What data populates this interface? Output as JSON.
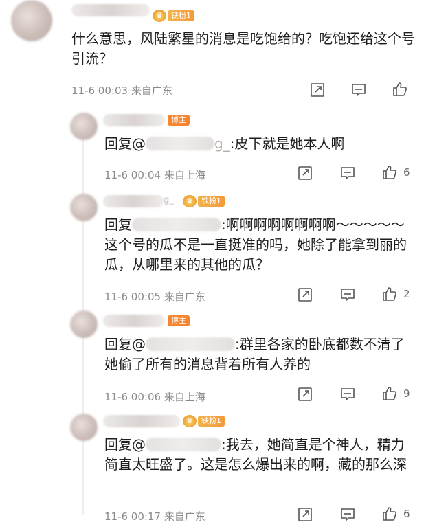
{
  "comments": [
    {
      "badge": "铁粉1",
      "text": "什么意思，风陆繁星的消息是吃饱给的？吃饱还给这个号引流？",
      "time": "11-6 00:03",
      "location": "来自广东",
      "likes": ""
    }
  ],
  "replies": [
    {
      "badge": "博主",
      "reply_prefix": "回复@",
      "mention_tail": "g_",
      "text": ":皮下就是她本人啊",
      "time": "11-6 00:04",
      "location": "来自上海",
      "likes": "6"
    },
    {
      "username_tail": "g_",
      "badge": "铁粉1",
      "reply_prefix": "回复",
      "mention_tail": "",
      "text": ":啊啊啊啊啊啊啊啊～～～～～这个号的瓜不是一直挺准的吗，她除了能拿到丽的瓜，从哪里来的其他的瓜？",
      "time": "11-6 00:05",
      "location": "来自广东",
      "likes": "2"
    },
    {
      "badge": "博主",
      "reply_prefix": "回复@",
      "mention_tail": "",
      "text": ":群里各家的卧底都数不清了她偷了所有的消息背着所有人养的",
      "time": "11-6 00:06",
      "location": "来自上海",
      "likes": "9"
    },
    {
      "badge": "铁粉1",
      "reply_prefix": "回复@",
      "mention_tail": "",
      "text": ":我去，她简直是个神人，精力简直太旺盛了。这是怎么爆出来的啊，藏的那么深",
      "time": "11-6 00:17",
      "location": "来自广东",
      "likes": "6"
    }
  ],
  "icons": [
    "share-icon",
    "comment-icon",
    "like-icon"
  ]
}
